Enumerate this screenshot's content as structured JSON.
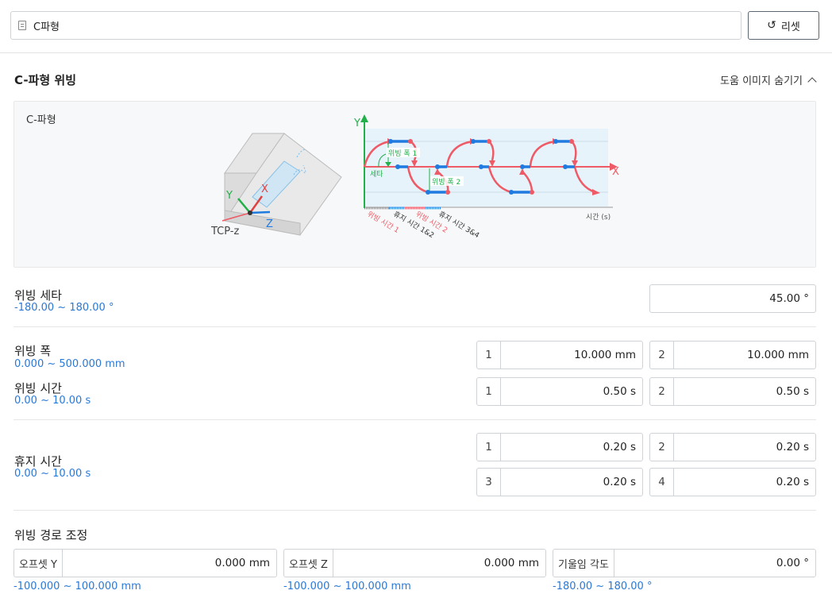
{
  "header": {
    "name_value": "C파형",
    "reset_label": "리셋"
  },
  "section": {
    "title": "C-파형 위빙",
    "help_toggle_label": "도움 이미지 숨기기"
  },
  "help_image": {
    "caption": "C-파형",
    "labels": {
      "y_axis": "Y",
      "x_axis": "X",
      "axis_y": "Y",
      "axis_x": "X",
      "axis_z": "Z",
      "tcp": "TCP-z",
      "width1": "위빙 폭 1",
      "width2": "위빙 폭 2",
      "theta": "세타",
      "time_axis": "시간 (s)",
      "weave_time1": "위빙 시간 1",
      "dwell_time12": "휴지 시간 1&2",
      "weave_time2": "위빙 시간 2",
      "dwell_time34": "휴지 시간 3&4"
    }
  },
  "theta": {
    "label": "위빙 세타",
    "range": "-180.00 ~ 180.00 °",
    "value": "45.00 °"
  },
  "width": {
    "label": "위빙 폭",
    "range": "0.000 ~ 500.000 mm",
    "fields": [
      {
        "idx": "1",
        "value": "10.000 mm"
      },
      {
        "idx": "2",
        "value": "10.000 mm"
      }
    ]
  },
  "weave_time": {
    "label": "위빙 시간",
    "range": "0.00 ~ 10.00 s",
    "fields": [
      {
        "idx": "1",
        "value": "0.50 s"
      },
      {
        "idx": "2",
        "value": "0.50 s"
      }
    ]
  },
  "dwell": {
    "label": "휴지 시간",
    "range": "0.00 ~ 10.00 s",
    "fields": [
      {
        "idx": "1",
        "value": "0.20 s"
      },
      {
        "idx": "2",
        "value": "0.20 s"
      },
      {
        "idx": "3",
        "value": "0.20 s"
      },
      {
        "idx": "4",
        "value": "0.20 s"
      }
    ]
  },
  "path_adjust": {
    "label": "위빙 경로 조정",
    "fields": [
      {
        "prefix": "오프셋 Y",
        "value": "0.000 mm",
        "range": "-100.000 ~ 100.000 mm"
      },
      {
        "prefix": "오프셋 Z",
        "value": "0.000 mm",
        "range": "-100.000 ~ 100.000 mm"
      },
      {
        "prefix": "기울임 각도",
        "value": "0.00 °",
        "range": "-180.00 ~ 180.00 °"
      }
    ]
  },
  "colors": {
    "accent": "#2a78d6",
    "path_red": "#ee5a66",
    "blue": "#1f7be0",
    "green": "#22b04a"
  }
}
